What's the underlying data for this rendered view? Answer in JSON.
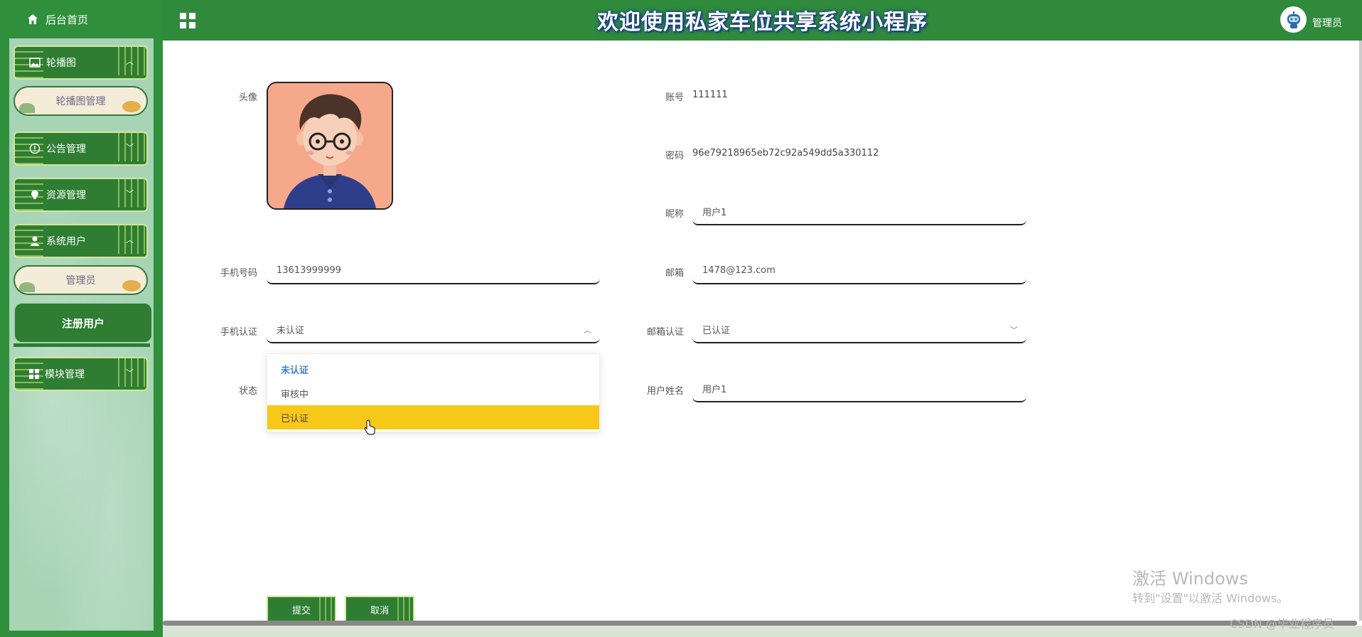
{
  "header": {
    "title": "欢迎使用私家车位共享系统小程序",
    "user_label": "管理员"
  },
  "sidebar": {
    "home_label": "后台首页",
    "menus": [
      {
        "label": "轮播图",
        "expanded": true,
        "icon": "image-icon"
      },
      {
        "label": "公告管理",
        "expanded": false,
        "icon": "info-icon"
      },
      {
        "label": "资源管理",
        "expanded": false,
        "icon": "bulb-icon"
      },
      {
        "label": "系统用户",
        "expanded": true,
        "icon": "user-icon"
      },
      {
        "label": "模块管理",
        "expanded": false,
        "icon": "grid-icon"
      }
    ],
    "sub_items": {
      "carousel_manage": "轮播图管理",
      "admin": "管理员",
      "registered_users": "注册用户"
    }
  },
  "form": {
    "avatar_label": "头像",
    "account_label": "账号",
    "account_value": "111111",
    "password_label": "密码",
    "password_value": "96e79218965eb72c92a549dd5a330112",
    "nickname_label": "昵称",
    "nickname_value": "用户1",
    "phone_label": "手机号码",
    "phone_value": "13613999999",
    "email_label": "邮箱",
    "email_value": "1478@123.com",
    "phone_verify_label": "手机认证",
    "phone_verify_value": "未认证",
    "email_verify_label": "邮箱认证",
    "email_verify_value": "已认证",
    "status_label": "状态",
    "username_label": "用户姓名",
    "username_value": "用户1",
    "dropdown_options": [
      "未认证",
      "审核中",
      "已认证"
    ],
    "submit_label": "提交",
    "cancel_label": "取消"
  },
  "overlay": {
    "activate_title": "激活 Windows",
    "activate_sub": "转到\"设置\"以激活 Windows。",
    "csdn": "CSDN @毕业程序员"
  },
  "colors": {
    "primary_green": "#2e7d32",
    "header_green": "#2f8a3c",
    "sidebar_panel": "#a8d4b6",
    "dropdown_hover": "#f8c819",
    "dropdown_selected": "#3b7fd9"
  }
}
